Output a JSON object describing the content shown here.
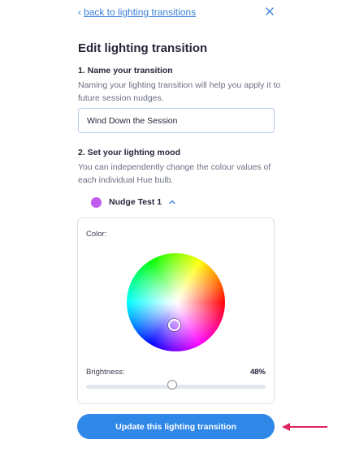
{
  "nav": {
    "back_chevron": "‹",
    "back_label": "back to lighting transitions",
    "close_icon": "close-icon"
  },
  "page_title": "Edit lighting transition",
  "name_section": {
    "heading": "1. Name your transition",
    "description": "Naming your lighting transition will help you apply it to future session nudges.",
    "input_value": "Wind Down the Session"
  },
  "mood_section": {
    "heading": "2. Set your lighting mood",
    "description": "You can independently change the colour values of each individual Hue bulb."
  },
  "bulb": {
    "name": "Nudge Test 1",
    "color": "#c15cf0",
    "expanded": true
  },
  "color_picker": {
    "color_label": "Color:",
    "brightness_label": "Brightness:",
    "brightness_value": "48%",
    "brightness_fraction": 0.48
  },
  "update_button_label": "Update this lighting transition",
  "colors": {
    "accent": "#2f87e8",
    "link": "#3a7fd6",
    "annotation_arrow": "#e0245e"
  }
}
